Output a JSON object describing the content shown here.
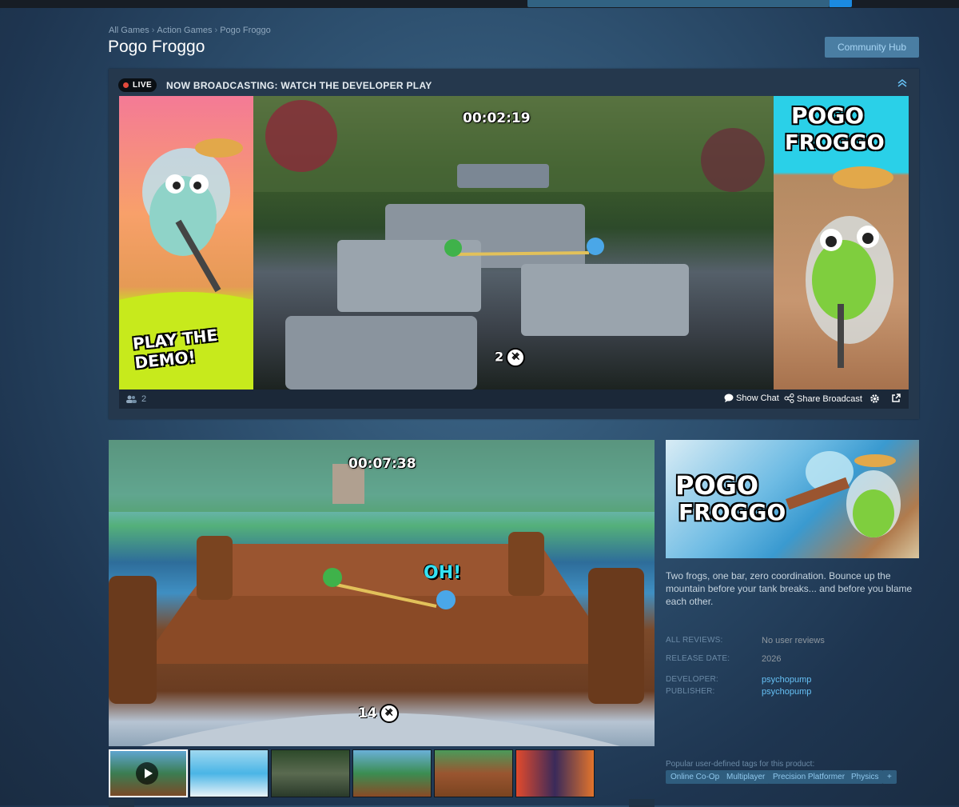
{
  "breadcrumbs": [
    "All Games",
    "Action Games",
    "Pogo Froggo"
  ],
  "page_title": "Pogo Froggo",
  "community_hub_label": "Community Hub",
  "broadcast": {
    "live_label": "LIVE",
    "title": "NOW BROADCASTING: WATCH THE DEVELOPER PLAY",
    "video": {
      "timer": "00:02:19",
      "counter": "2",
      "left_panel_text": "PLAY THE DEMO!",
      "right_panel_logo": [
        "POGO",
        "FROGGO"
      ]
    },
    "viewer_count": "2",
    "show_chat_label": "Show Chat",
    "share_label": "Share Broadcast"
  },
  "media": {
    "timer": "00:07:38",
    "exclaim": "OH!",
    "counter": "14",
    "thumbnail_count": 6
  },
  "capsule_logo": [
    "POGO",
    "FROGGO"
  ],
  "description": "Two frogs, one bar, zero coordination. Bounce up the mountain before your tank breaks... and before you blame each other.",
  "info": {
    "reviews_label": "ALL REVIEWS:",
    "reviews_value": "No user reviews",
    "release_label": "RELEASE DATE:",
    "release_value": "2026",
    "developer_label": "DEVELOPER:",
    "developer_value": "psychopump",
    "publisher_label": "PUBLISHER:",
    "publisher_value": "psychopump"
  },
  "tags_label": "Popular user-defined tags for this product:",
  "tags": [
    "Online Co-Op",
    "Multiplayer",
    "Precision Platformer",
    "Physics",
    "+"
  ],
  "colors": {
    "accent_link": "#66c0f4",
    "tag_bg": "#2f5d7e",
    "live_dot": "#e24a3c",
    "hub_button": "#4a7ea3"
  }
}
